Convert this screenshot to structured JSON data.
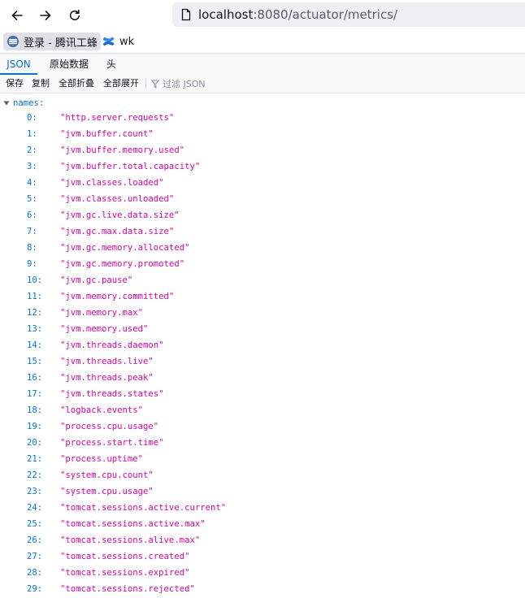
{
  "browser": {
    "url_host": "localhost",
    "url_rest": ":8080/actuator/metrics/"
  },
  "bookmarks": [
    {
      "label": "登录 - 腾讯工蜂",
      "icon": "tgit-logo-icon"
    },
    {
      "label": "wk",
      "icon": "confluence-logo-icon"
    }
  ],
  "viewer": {
    "tabs": [
      "JSON",
      "原始数据",
      "头"
    ],
    "toolbar": {
      "save": "保存",
      "copy": "复制",
      "collapse_all": "全部折叠",
      "expand_all": "全部展开",
      "filter_placeholder": "过滤 JSON"
    }
  },
  "json": {
    "root_key": "names:",
    "items": [
      {
        "k": "0:",
        "v": "\"http.server.requests\""
      },
      {
        "k": "1:",
        "v": "\"jvm.buffer.count\""
      },
      {
        "k": "2:",
        "v": "\"jvm.buffer.memory.used\""
      },
      {
        "k": "3:",
        "v": "\"jvm.buffer.total.capacity\""
      },
      {
        "k": "4:",
        "v": "\"jvm.classes.loaded\""
      },
      {
        "k": "5:",
        "v": "\"jvm.classes.unloaded\""
      },
      {
        "k": "6:",
        "v": "\"jvm.gc.live.data.size\""
      },
      {
        "k": "7:",
        "v": "\"jvm.gc.max.data.size\""
      },
      {
        "k": "8:",
        "v": "\"jvm.gc.memory.allocated\""
      },
      {
        "k": "9:",
        "v": "\"jvm.gc.memory.promoted\""
      },
      {
        "k": "10:",
        "v": "\"jvm.gc.pause\""
      },
      {
        "k": "11:",
        "v": "\"jvm.memory.committed\""
      },
      {
        "k": "12:",
        "v": "\"jvm.memory.max\""
      },
      {
        "k": "13:",
        "v": "\"jvm.memory.used\""
      },
      {
        "k": "14:",
        "v": "\"jvm.threads.daemon\""
      },
      {
        "k": "15:",
        "v": "\"jvm.threads.live\""
      },
      {
        "k": "16:",
        "v": "\"jvm.threads.peak\""
      },
      {
        "k": "17:",
        "v": "\"jvm.threads.states\""
      },
      {
        "k": "18:",
        "v": "\"logback.events\""
      },
      {
        "k": "19:",
        "v": "\"process.cpu.usage\""
      },
      {
        "k": "20:",
        "v": "\"process.start.time\""
      },
      {
        "k": "21:",
        "v": "\"process.uptime\""
      },
      {
        "k": "22:",
        "v": "\"system.cpu.count\""
      },
      {
        "k": "23:",
        "v": "\"system.cpu.usage\""
      },
      {
        "k": "24:",
        "v": "\"tomcat.sessions.active.current\""
      },
      {
        "k": "25:",
        "v": "\"tomcat.sessions.active.max\""
      },
      {
        "k": "26:",
        "v": "\"tomcat.sessions.alive.max\""
      },
      {
        "k": "27:",
        "v": "\"tomcat.sessions.created\""
      },
      {
        "k": "28:",
        "v": "\"tomcat.sessions.expired\""
      },
      {
        "k": "29:",
        "v": "\"tomcat.sessions.rejected\""
      }
    ]
  },
  "colors": {
    "key": "#0074e8",
    "string": "#dd00a9",
    "tab_active": "#0074e8"
  }
}
